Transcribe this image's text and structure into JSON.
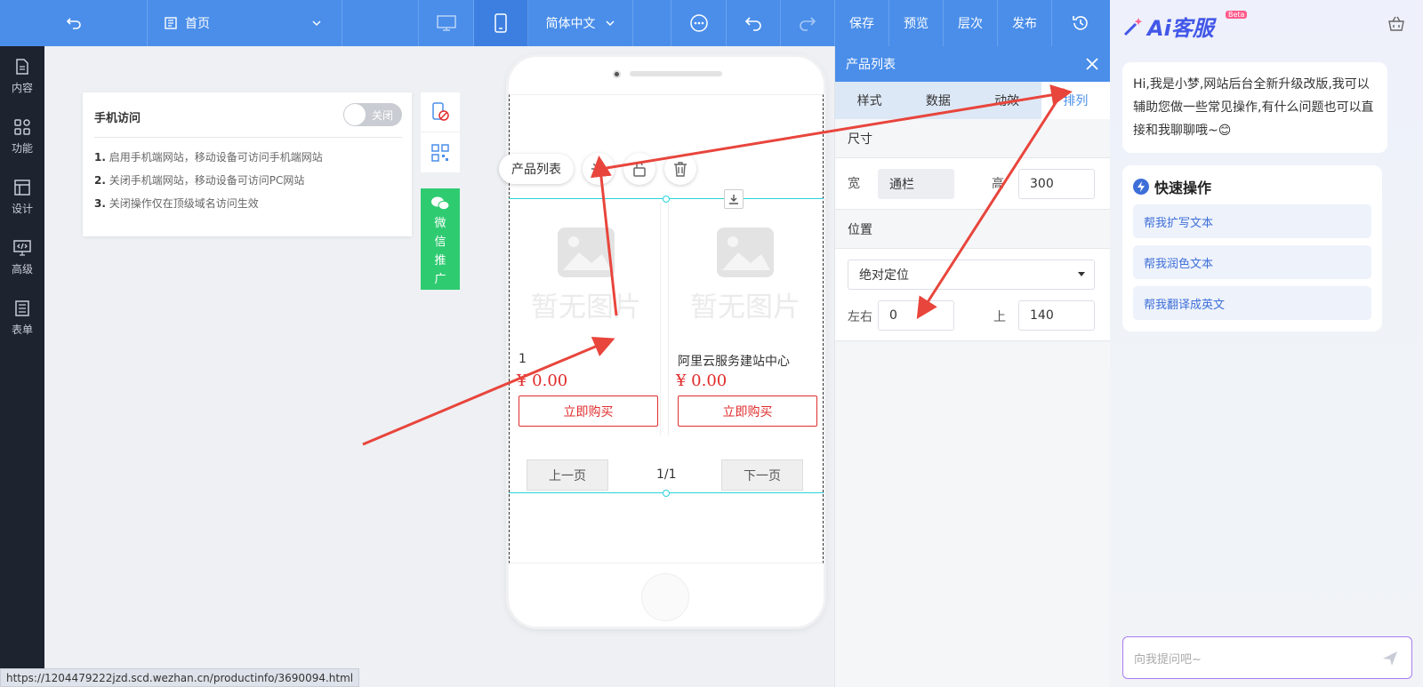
{
  "topbar": {
    "page_name": "首页",
    "language": "简体中文",
    "save": "保存",
    "preview": "预览",
    "layers": "层次",
    "publish": "发布"
  },
  "sidebar": {
    "items": [
      {
        "label": "内容",
        "icon": "document-icon"
      },
      {
        "label": "功能",
        "icon": "grid-icon"
      },
      {
        "label": "设计",
        "icon": "layout-icon"
      },
      {
        "label": "高级",
        "icon": "code-monitor-icon"
      },
      {
        "label": "表单",
        "icon": "form-icon"
      }
    ]
  },
  "mobile_panel": {
    "title": "手机访问",
    "toggle_label": "关闭",
    "notes": [
      {
        "num": "1.",
        "text": "启用手机端网站，移动设备可访问手机端网站"
      },
      {
        "num": "2.",
        "text": "关闭手机端网站，移动设备可访问PC网站"
      },
      {
        "num": "3.",
        "text": "关闭操作仅在顶级域名访问生效"
      }
    ],
    "wechat_label": [
      "微",
      "信",
      "推",
      "广"
    ]
  },
  "phone": {
    "component_label": "产品列表",
    "no_image_text": "暂无图片",
    "products": [
      {
        "name": "1",
        "price": "¥ 0.00",
        "buy": "立即购买"
      },
      {
        "name": "阿里云服务建站中心",
        "price": "¥ 0.00",
        "buy": "立即购买"
      }
    ],
    "pager": {
      "prev": "上一页",
      "status": "1/1",
      "next": "下一页"
    }
  },
  "props": {
    "title": "产品列表",
    "tabs": [
      "样式",
      "数据",
      "动效",
      "排列"
    ],
    "active_tab": "排列",
    "size": {
      "title": "尺寸",
      "width_label": "宽",
      "width_value": "通栏",
      "height_label": "高",
      "height_value": "300"
    },
    "position": {
      "title": "位置",
      "mode": "绝对定位",
      "lr_label": "左右",
      "lr_value": "0",
      "top_label": "上",
      "top_value": "140"
    }
  },
  "ai": {
    "brand": "Ai客服",
    "beta": "Beta",
    "greeting": "Hi,我是小梦,网站后台全新升级改版,我可以辅助您做一些常见操作,有什么问题也可以直接和我聊聊哦~😊",
    "quick_title": "快速操作",
    "quick_items": [
      "帮我扩写文本",
      "帮我润色文本",
      "帮我翻译成英文"
    ],
    "input_placeholder": "向我提问吧~"
  },
  "status_url": "https://1204479222jzd.scd.wezhan.cn/productinfo/3690094.html",
  "colors": {
    "topbar": "#4a8eea",
    "sidebar": "#1e2330",
    "price": "#e02d2d",
    "selection": "#2ad2d8",
    "wechat": "#2fcb71",
    "arrow": "#e8453c"
  }
}
